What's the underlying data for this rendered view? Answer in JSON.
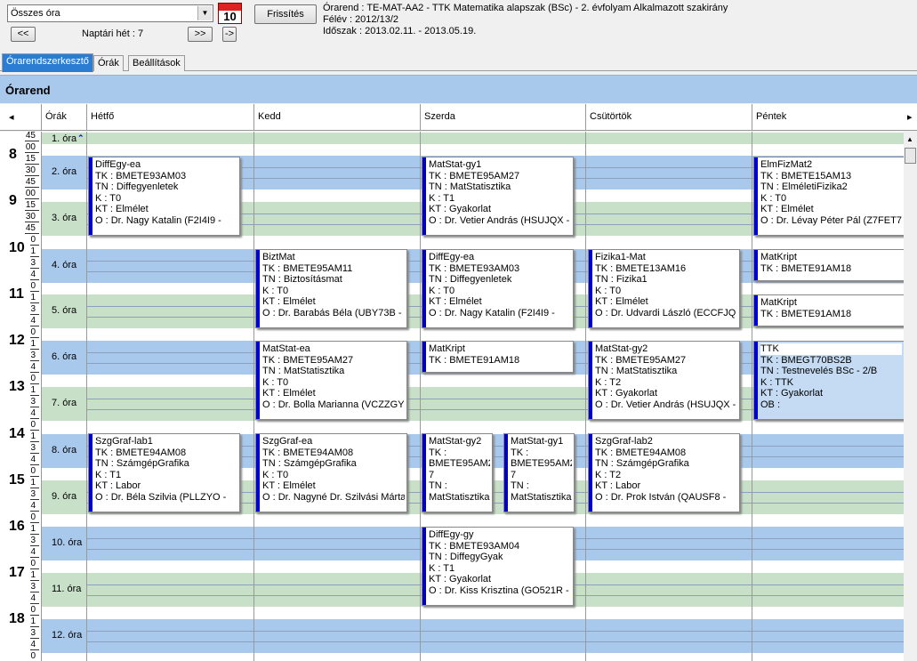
{
  "toolbar": {
    "filter_value": "Összes óra",
    "calendar_day": "10",
    "refresh_label": "Frissítés",
    "prev_label": "<<",
    "next_label": ">>",
    "goto_label": "->",
    "week_label": "Naptári hét : 7"
  },
  "info": {
    "line1": "Órarend : TE-MAT-AA2 - TTK Matematika alapszak (BSc) - 2. évfolyam Alkalmazott szakirány",
    "line2": "Félév : 2012/13/2",
    "line3": "Időszak : 2013.02.11. - 2013.05.19."
  },
  "tabs": [
    "Órarendszerkesztő",
    "Órák",
    "Beállítások"
  ],
  "panel_title": "Órarend",
  "columns": {
    "scroll_left": "◂",
    "scroll_right": "▸",
    "hours": "Órák",
    "days": [
      "Hétfő",
      "Kedd",
      "Szerda",
      "Csütörtök",
      "Péntek"
    ]
  },
  "time": {
    "ticks": [
      "45",
      "00",
      "15",
      "30",
      "45",
      "00",
      "15",
      "30",
      "45",
      "0",
      "1",
      "3",
      "4",
      "0",
      "1",
      "3",
      "4",
      "0",
      "1",
      "3",
      "4",
      "0",
      "1",
      "3",
      "4",
      "0",
      "1",
      "3",
      "4",
      "0",
      "1",
      "3",
      "4",
      "0",
      "1",
      "3",
      "4",
      "0",
      "1",
      "3",
      "4",
      "0",
      "1",
      "3",
      "4",
      "0",
      "1",
      "3",
      "4"
    ],
    "hours": [
      "8",
      "9",
      "10",
      "11",
      "12",
      "13",
      "14",
      "15",
      "16",
      "17",
      "18"
    ]
  },
  "slots": [
    "1. óra",
    "2. óra",
    "3. óra",
    "4. óra",
    "5. óra",
    "6. óra",
    "7. óra",
    "8. óra",
    "9. óra",
    "10. óra",
    "11. óra",
    "12. óra"
  ],
  "events": [
    {
      "lines": [
        "DiffEgy-ea",
        "TK : BMETE93AM03",
        "TN : Diffegyenletek",
        "K : T0",
        "KT : Elmélet",
        "O :  Dr. Nagy Katalin (F2I4I9 -"
      ]
    },
    {
      "lines": [
        "MatStat-gy1",
        "TK : BMETE95AM27",
        "TN : MatStatisztika",
        "K : T1",
        "KT : Gyakorlat",
        "O :  Dr. Vetier András (HSUJQX -"
      ]
    },
    {
      "lines": [
        "ElmFizMat2",
        "TK : BMETE15AM13",
        "TN : ElméletiFizika2",
        "K : T0",
        "KT : Elmélet",
        "O :  Dr. Lévay Péter Pál (Z7FET7 -"
      ]
    },
    {
      "lines": [
        "BiztMat",
        "TK : BMETE95AM11",
        "TN : Biztosításmat",
        "K : T0",
        "KT : Elmélet",
        "O :  Dr. Barabás Béla (UBY73B -"
      ]
    },
    {
      "lines": [
        "DiffEgy-ea",
        "TK : BMETE93AM03",
        "TN : Diffegyenletek",
        "K : T0",
        "KT : Elmélet",
        "O :  Dr. Nagy Katalin (F2I4I9 -"
      ]
    },
    {
      "lines": [
        "Fizika1-Mat",
        "TK : BMETE13AM16",
        "TN : Fizika1",
        "K : T0",
        "KT : Elmélet",
        "O :  Dr. Udvardi László (ECCFJQ -"
      ]
    },
    {
      "lines": [
        "MatKript",
        "TK : BMETE91AM18"
      ]
    },
    {
      "lines": [
        "MatKript",
        "TK : BMETE91AM18"
      ]
    },
    {
      "lines": [
        "MatStat-ea",
        "TK : BMETE95AM27",
        "TN : MatStatisztika",
        "K : T0",
        "KT : Elmélet",
        "O :  Dr. Bolla Marianna (VCZZGY -"
      ]
    },
    {
      "lines": [
        "MatKript",
        "TK : BMETE91AM18"
      ]
    },
    {
      "lines": [
        "MatStat-gy2",
        "TK : BMETE95AM27",
        "TN : MatStatisztika",
        "K : T2",
        "KT : Gyakorlat",
        "O :  Dr. Vetier András (HSUJQX -"
      ]
    },
    {
      "lines": [
        "TTK",
        "TK : BMEGT70BS2B",
        "TN : Testnevelés BSc - 2/B",
        "K : TTK",
        "KT : Gyakorlat",
        "OB :"
      ]
    },
    {
      "lines": [
        "SzgGraf-lab1",
        "TK : BMETE94AM08",
        "TN : SzámgépGrafika",
        "K : T1",
        "KT : Labor",
        "O :  Dr. Béla Szilvia (PLLZYO -"
      ]
    },
    {
      "lines": [
        "SzgGraf-ea",
        "TK : BMETE94AM08",
        "TN : SzámgépGrafika",
        "K : T0",
        "KT : Elmélet",
        "O :  Dr. Nagyné Dr. Szilvási Márta"
      ]
    },
    {
      "lines": [
        "MatStat-gy2",
        "TK :",
        "BMETE95AM2",
        "7",
        "TN :",
        "MatStatisztika"
      ]
    },
    {
      "lines": [
        "MatStat-gy1",
        "TK :",
        "BMETE95AM2",
        "7",
        "TN :",
        "MatStatisztika"
      ]
    },
    {
      "lines": [
        "SzgGraf-lab2",
        "TK : BMETE94AM08",
        "TN : SzámgépGrafika",
        "K : T2",
        "KT : Labor",
        "O :  Dr. Prok István (QAUSF8 -"
      ]
    },
    {
      "lines": [
        "DiffEgy-gy",
        "TK : BMETE93AM04",
        "TN : DiffegyGyak",
        "K : T1",
        "KT : Gyakorlat",
        "O :  Dr. Kiss Krisztina (GO521R -"
      ]
    }
  ],
  "colors": {
    "blue_band": "#a8c8ec",
    "green_band": "#c8e0c8",
    "accent": "#0000cc"
  },
  "icons": {
    "collapse": "double-chevron-up-icon",
    "scroll_up": "triangle-up-icon"
  }
}
